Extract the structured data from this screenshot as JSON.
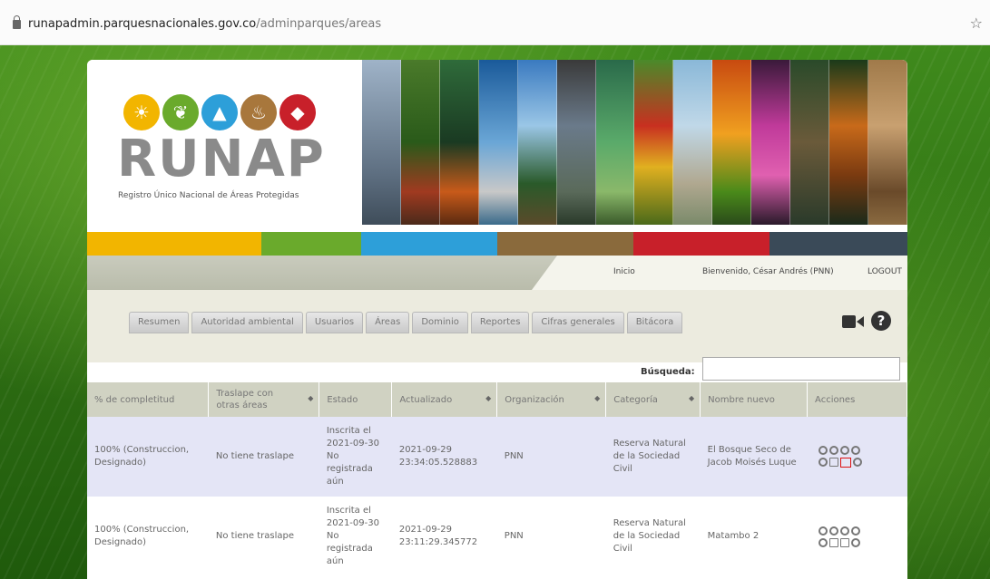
{
  "browser": {
    "url_host": "runapadmin.parquesnacionales.gov.co",
    "url_path": "/adminparques/areas"
  },
  "logo": {
    "word": "RUNAP",
    "subtitle": "Registro Único Nacional de Áreas Protegidas"
  },
  "userbar": {
    "home": "Inicio",
    "welcome": "Bienvenido, César Andrés (PNN)",
    "logout": "LOGOUT"
  },
  "tabs": [
    {
      "label": "Resumen"
    },
    {
      "label": "Autoridad ambiental"
    },
    {
      "label": "Usuarios"
    },
    {
      "label": "Áreas"
    },
    {
      "label": "Dominio"
    },
    {
      "label": "Reportes"
    },
    {
      "label": "Cifras generales"
    },
    {
      "label": "Bitácora"
    }
  ],
  "search": {
    "label": "Búsqueda:",
    "value": ""
  },
  "table": {
    "headers": [
      "% de completitud",
      "Traslape con otras áreas",
      "Estado",
      "Actualizado",
      "Organización",
      "Categoría",
      "Nombre nuevo",
      "Acciones"
    ],
    "rows": [
      {
        "completitud": "100% (Construccion, Designado)",
        "traslape": "No tiene traslape",
        "estado": "Inscrita el 2021-09-30 No registrada aún",
        "actualizado": "2021-09-29 23:34:05.528883",
        "organizacion": "PNN",
        "categoria": "Reserva Natural de la Sociedad Civil",
        "nombre": "El Bosque Seco de Jacob Moisés Luque"
      },
      {
        "completitud": "100% (Construccion, Designado)",
        "traslape": "No tiene traslape",
        "estado": "Inscrita el 2021-09-30 No registrada aún",
        "actualizado": "2021-09-29 23:11:29.345772",
        "organizacion": "PNN",
        "categoria": "Reserva Natural de la Sociedad Civil",
        "nombre": "Matambo 2"
      }
    ]
  },
  "colors": {
    "bar_yellow": "#f2b500",
    "bar_green": "#6aaa2c",
    "bar_blue": "#2d9fd9",
    "bar_brown": "#8a6a3c",
    "bar_red": "#c8202a",
    "bar_slate": "#3a4a58"
  }
}
